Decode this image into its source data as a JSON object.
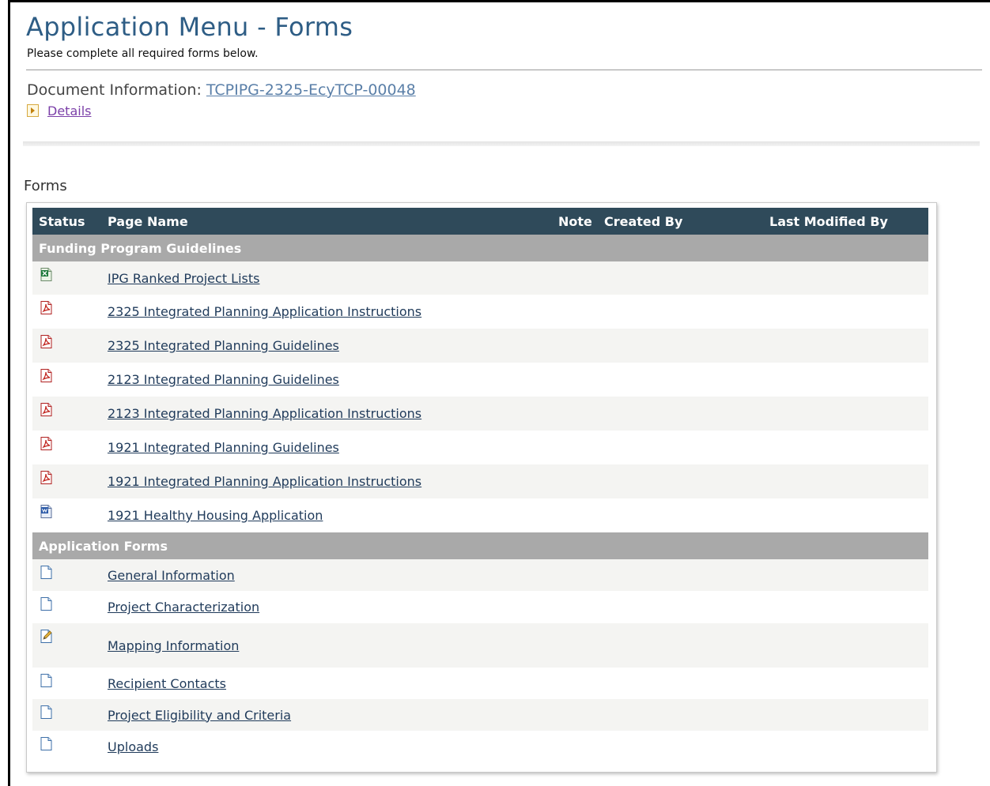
{
  "header": {
    "title": "Application Menu - Forms",
    "subtitle": "Please complete all required forms below."
  },
  "document": {
    "label": "Document Information:",
    "id": "TCPIPG-2325-EcyTCP-00048",
    "details_link": "Details"
  },
  "forms_section_label": "Forms",
  "table": {
    "columns": [
      "Status",
      "Page Name",
      "Note",
      "Created By",
      "Last Modified By"
    ],
    "groups": [
      {
        "title": "Funding Program Guidelines",
        "rows": [
          {
            "icon": "excel-file-icon",
            "name": "IPG Ranked Project Lists"
          },
          {
            "icon": "pdf-file-icon",
            "name": "2325 Integrated Planning Application Instructions"
          },
          {
            "icon": "pdf-file-icon",
            "name": "2325 Integrated Planning Guidelines"
          },
          {
            "icon": "pdf-file-icon",
            "name": "2123 Integrated Planning Guidelines"
          },
          {
            "icon": "pdf-file-icon",
            "name": "2123 Integrated Planning Application Instructions"
          },
          {
            "icon": "pdf-file-icon",
            "name": "1921 Integrated Planning Guidelines"
          },
          {
            "icon": "pdf-file-icon",
            "name": "1921 Integrated Planning Application Instructions"
          },
          {
            "icon": "word-file-icon",
            "name": "1921 Healthy Housing Application"
          }
        ]
      },
      {
        "title": "Application Forms",
        "rows": [
          {
            "icon": "blank-page-icon",
            "name": "General Information"
          },
          {
            "icon": "blank-page-icon",
            "name": "Project Characterization"
          },
          {
            "icon": "edit-page-icon",
            "name": "Mapping Information"
          },
          {
            "icon": "blank-page-icon",
            "name": "Recipient Contacts"
          },
          {
            "icon": "blank-page-icon",
            "name": "Project Eligibility and Criteria"
          },
          {
            "icon": "blank-page-icon",
            "name": "Uploads"
          }
        ]
      }
    ]
  },
  "colors": {
    "title": "#2e5d85",
    "header_bg": "#2f4a5a",
    "group_bg": "#a9a9a9",
    "link": "#1f3a5a"
  }
}
